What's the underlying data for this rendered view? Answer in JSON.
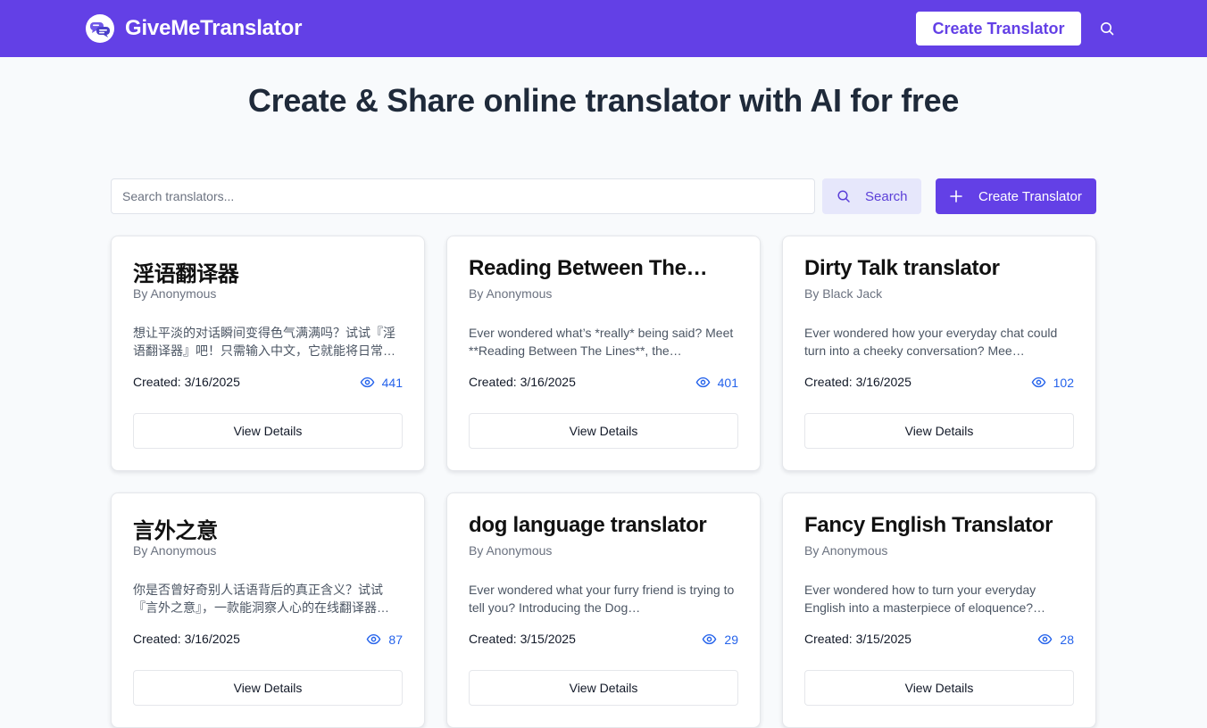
{
  "header": {
    "brand_name": "GiveMeTranslator",
    "create_label": "Create Translator",
    "brand_color": "#6340e6"
  },
  "hero": {
    "title": "Create & Share online translator with AI for free"
  },
  "toolbar": {
    "search_placeholder": "Search translators...",
    "search_value": "",
    "search_label": "Search",
    "create_label": "Create Translator"
  },
  "cards": [
    {
      "title": "淫语翻译器",
      "author": "By Anonymous",
      "description": "想让平淡的对话瞬间变得色气满满吗？试试『淫语翻译器』吧！只需输入中文，它就能将日常…",
      "created": "Created: 3/16/2025",
      "views": "441",
      "button_label": "View Details"
    },
    {
      "title": "Reading Between The…",
      "author": "By Anonymous",
      "description": "Ever wondered what’s *really* being said? Meet **Reading Between The Lines**, the…",
      "created": "Created: 3/16/2025",
      "views": "401",
      "button_label": "View Details"
    },
    {
      "title": "Dirty Talk translator",
      "author": "By Black Jack",
      "description": "Ever wondered how your everyday chat could turn into a cheeky conversation? Mee…",
      "created": "Created: 3/16/2025",
      "views": "102",
      "button_label": "View Details"
    },
    {
      "title": "言外之意",
      "author": "By Anonymous",
      "description": "你是否曾好奇别人话语背后的真正含义？试试『言外之意』，一款能洞察人心的在线翻译器…",
      "created": "Created: 3/16/2025",
      "views": "87",
      "button_label": "View Details"
    },
    {
      "title": "dog language translator",
      "author": "By Anonymous",
      "description": "Ever wondered what your furry friend is trying to tell you? Introducing the Dog…",
      "created": "Created: 3/15/2025",
      "views": "29",
      "button_label": "View Details"
    },
    {
      "title": "Fancy English Translator",
      "author": "By Anonymous",
      "description": "Ever wondered how to turn your everyday English into a masterpiece of eloquence?…",
      "created": "Created: 3/15/2025",
      "views": "28",
      "button_label": "View Details"
    }
  ]
}
